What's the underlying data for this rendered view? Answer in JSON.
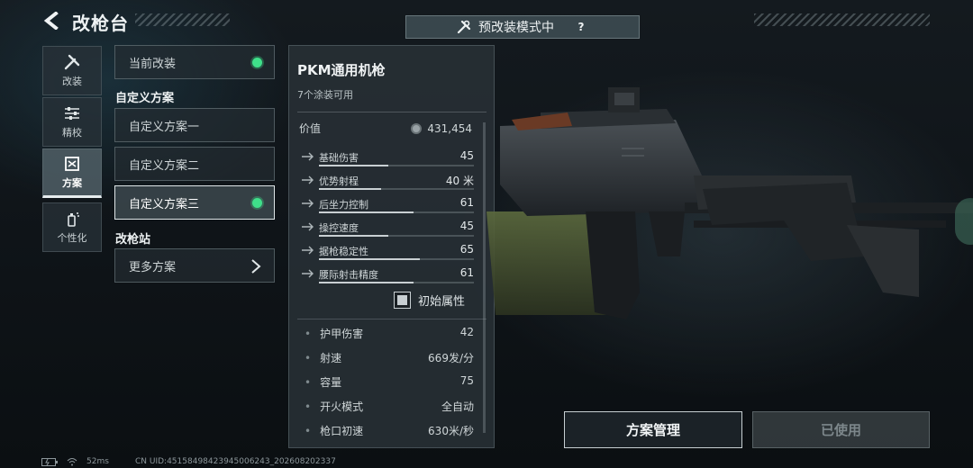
{
  "header": {
    "title": "改枪台",
    "mode_banner": "预改装模式中",
    "help_label": "?"
  },
  "nav": [
    {
      "label": "改装",
      "icon": "wrench-screwdriver-icon"
    },
    {
      "label": "精校",
      "icon": "sliders-icon"
    },
    {
      "label": "方案",
      "icon": "scheme-icon"
    },
    {
      "label": "个性化",
      "icon": "spray-can-icon"
    }
  ],
  "schemes": {
    "current": "当前改装",
    "custom_section": "自定义方案",
    "custom": [
      "自定义方案一",
      "自定义方案二",
      "自定义方案三"
    ],
    "station_section": "改枪站",
    "more": "更多方案"
  },
  "weapon": {
    "name": "PKM通用机枪",
    "skins": "7个涂装可用",
    "price_label": "价值",
    "price": "431,454",
    "stats": [
      {
        "label": "基础伤害",
        "value": "45",
        "bar": 0.45,
        "icon": "damage-icon"
      },
      {
        "label": "优势射程",
        "value": "40 米",
        "bar": 0.4,
        "icon": "range-icon"
      },
      {
        "label": "后坐力控制",
        "value": "61",
        "bar": 0.61,
        "icon": "recoil-icon"
      },
      {
        "label": "操控速度",
        "value": "45",
        "bar": 0.45,
        "icon": "handling-icon"
      },
      {
        "label": "据枪稳定性",
        "value": "65",
        "bar": 0.65,
        "icon": "stability-icon"
      },
      {
        "label": "腰际射击精度",
        "value": "61",
        "bar": 0.61,
        "icon": "hipfire-icon"
      }
    ],
    "toggle_label": "初始属性",
    "extra": [
      {
        "label": "护甲伤害",
        "value": "42"
      },
      {
        "label": "射速",
        "value": "669发/分"
      },
      {
        "label": "容量",
        "value": "75"
      },
      {
        "label": "开火模式",
        "value": "全自动"
      },
      {
        "label": "枪口初速",
        "value": "630米/秒"
      }
    ]
  },
  "actions": {
    "manage": "方案管理",
    "used": "已使用"
  },
  "footer": {
    "ping": "52ms",
    "uid": "CN UID:4515849842394500624​3_202608202337"
  },
  "colors": {
    "active_dot": "#3fe08a",
    "background": "#11171b"
  }
}
